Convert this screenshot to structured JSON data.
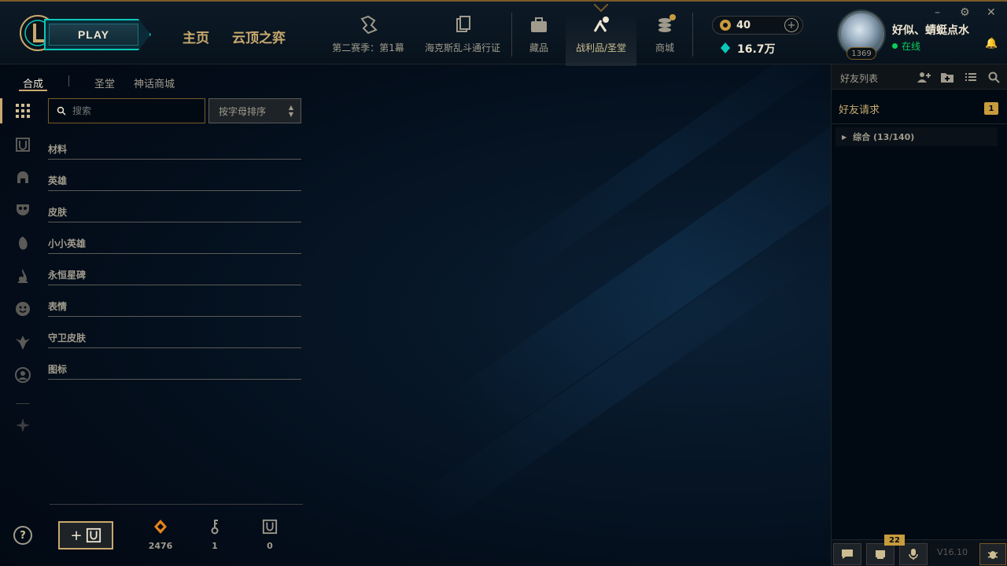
{
  "topbar": {
    "play_label": "PLAY",
    "nav_main": [
      "主页",
      "云顶之弈"
    ],
    "nav_items": [
      {
        "label": "第二赛季：第1幕",
        "icon": "season-pass-icon"
      },
      {
        "label": "海克斯乱斗通行证",
        "icon": "event-pass-icon"
      },
      {
        "label": "藏品",
        "icon": "collection-icon"
      },
      {
        "label": "战利品/圣堂",
        "icon": "loot-icon"
      },
      {
        "label": "商城",
        "icon": "store-icon"
      }
    ],
    "active_nav": "战利品/圣堂",
    "rp_value": "40",
    "be_value": "16.7万",
    "summoner_name": "好似、蜻蜓点水",
    "level": "1369",
    "status": "在线"
  },
  "loot": {
    "tabs": [
      "合成",
      "圣堂",
      "神话商城"
    ],
    "active_tab": "合成",
    "search_placeholder": "搜索",
    "sort_label": "按字母排序",
    "categories": [
      "材料",
      "英雄",
      "皮肤",
      "小小英雄",
      "永恒星碑",
      "表情",
      "守卫皮肤",
      "图标"
    ],
    "help_label": "?",
    "resources": [
      {
        "icon": "orange-essence-icon",
        "value": "2476"
      },
      {
        "icon": "key-icon",
        "value": "1"
      },
      {
        "icon": "chest-icon",
        "value": "0"
      }
    ]
  },
  "friends": {
    "title": "好友列表",
    "friend_requests_label": "好友请求",
    "friend_requests_count": "1",
    "group_label": "综合 (13/140)",
    "notification_count": "22",
    "version": "V16.10"
  },
  "colors": {
    "gold": "#c8aa6e",
    "accent_teal": "#0ac8b9",
    "online_green": "#0acd58",
    "background": "#010a13"
  }
}
